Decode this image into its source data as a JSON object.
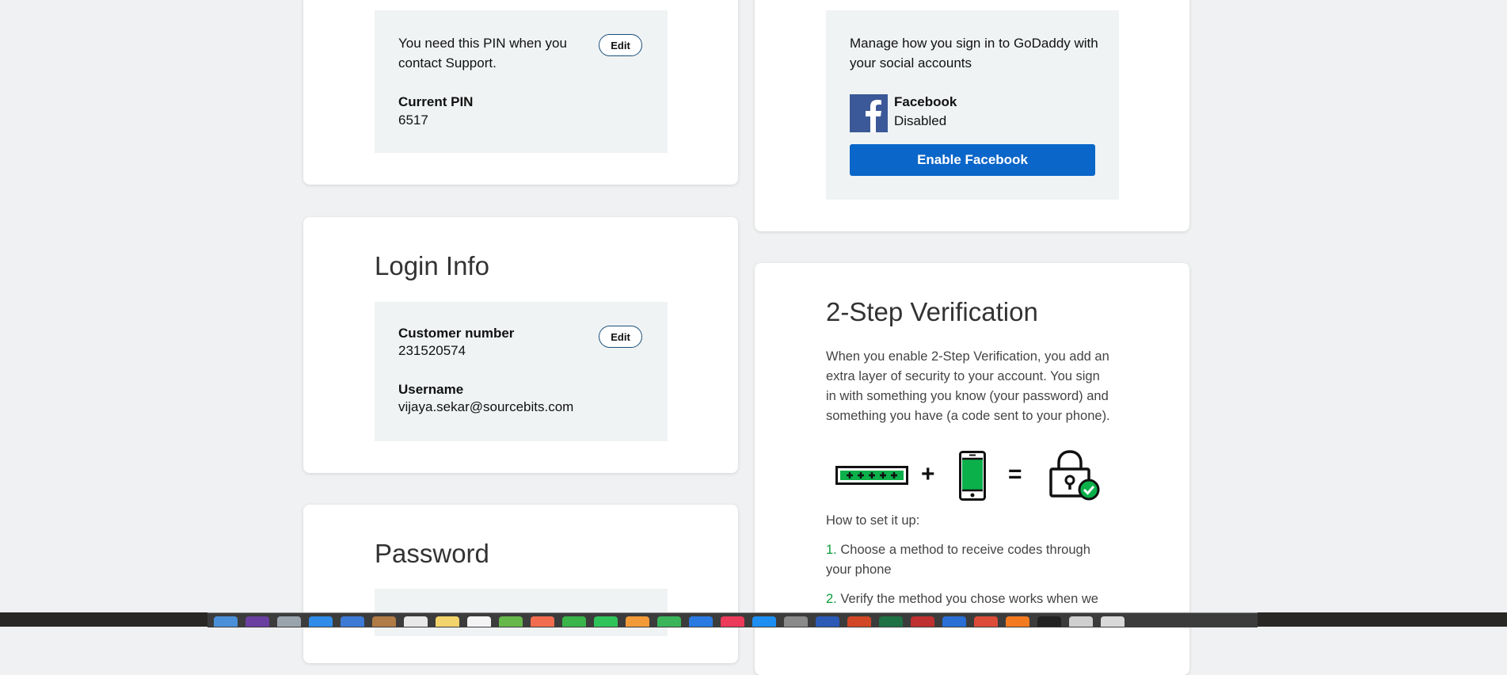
{
  "pin_card": {
    "description": "You need this PIN when you contact Support.",
    "edit_label": "Edit",
    "current_pin_label": "Current PIN",
    "current_pin_value": "6517"
  },
  "social_card": {
    "description": "Manage how you sign in to GoDaddy with your social accounts",
    "provider_name": "Facebook",
    "provider_status": "Disabled",
    "enable_button": "Enable Facebook",
    "brand_color": "#3b5998",
    "button_color": "#0a66c9"
  },
  "login_card": {
    "title": "Login Info",
    "edit_label": "Edit",
    "customer_number_label": "Customer number",
    "customer_number_value": "231520574",
    "username_label": "Username",
    "username_value": "vijaya.sekar@sourcebits.com"
  },
  "password_card": {
    "title": "Password"
  },
  "two_step_card": {
    "title": "2-Step Verification",
    "description": "When you enable 2-Step Verification, you add an extra layer of security to your account. You sign in with something you know (your password) and something you have (a code sent to your phone).",
    "plus": "+",
    "equals": "=",
    "how_to": "How to set it up:",
    "steps": [
      {
        "num": "1.",
        "text": "Choose a method to receive codes through your phone"
      },
      {
        "num": "2.",
        "text": "Verify the method you chose works when we"
      }
    ],
    "accent_color": "#0a9d3b"
  },
  "dock": {
    "icons": [
      "finder-icon",
      "siri-icon",
      "launchpad-icon",
      "safari-icon",
      "mail-icon",
      "contacts-icon",
      "calendar-icon",
      "notes-icon",
      "reminders-icon",
      "maps-icon",
      "photos-icon",
      "messages-icon",
      "facetime-icon",
      "pages-icon",
      "numbers-icon",
      "keynote-icon",
      "itunes-icon",
      "appstore-icon",
      "preferences-icon",
      "word-icon",
      "powerpoint-icon",
      "excel-icon",
      "filezilla-icon",
      "xcode-icon",
      "chrome-icon",
      "firefox-icon",
      "terminal-icon",
      "downloads-icon",
      "trash-icon"
    ]
  }
}
